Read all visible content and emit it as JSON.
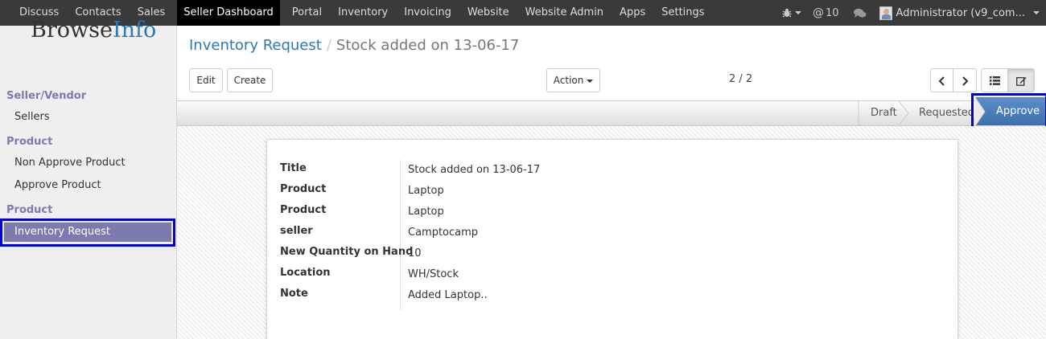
{
  "topnav": {
    "items": [
      "Discuss",
      "Contacts",
      "Sales",
      "Seller Dashboard",
      "Portal",
      "Inventory",
      "Invoicing",
      "Website",
      "Website Admin",
      "Apps",
      "Settings"
    ],
    "active": "Seller Dashboard",
    "message_count": "10",
    "user": "Administrator (v9_com..."
  },
  "sidebar": {
    "logo_main": "Browse",
    "logo_accent": "Info",
    "sections": [
      {
        "heading": "Seller/Vendor",
        "items": [
          "Sellers"
        ]
      },
      {
        "heading": "Product",
        "items": [
          "Non Approve Product",
          "Approve Product"
        ]
      },
      {
        "heading": "Product",
        "items": [
          "Inventory Request"
        ]
      }
    ],
    "active_item": "Inventory Request"
  },
  "breadcrumb": {
    "parent": "Inventory Request",
    "separator": "/",
    "current": "Stock added on 13-06-17"
  },
  "buttons": {
    "edit": "Edit",
    "create": "Create",
    "action": "Action"
  },
  "pager": {
    "label": "2 / 2"
  },
  "statusbar": {
    "stages": [
      "Draft",
      "Requested"
    ],
    "approve": "Approve"
  },
  "form": {
    "fields": [
      {
        "label": "Title",
        "value": "Stock added on 13-06-17"
      },
      {
        "label": "Product",
        "value": "Laptop"
      },
      {
        "label": "Product",
        "value": "Laptop"
      },
      {
        "label": "seller",
        "value": "Camptocamp"
      },
      {
        "label": "New Quantity on Hand",
        "value": "10"
      },
      {
        "label": "Location",
        "value": "WH/Stock"
      },
      {
        "label": "Note",
        "value": "Added Laptop.."
      }
    ]
  },
  "colors": {
    "topbar": "#3a3a3a",
    "accent": "#7c7bad",
    "link": "#2a7ab8",
    "highlight": "#0000d8",
    "approve": "#4a7fbf"
  }
}
